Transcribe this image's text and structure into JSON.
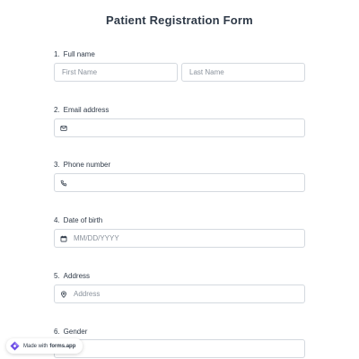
{
  "form": {
    "title": "Patient Registration Form"
  },
  "questions": [
    {
      "number": "1.",
      "label": "Full name",
      "fields": [
        {
          "placeholder": "First Name"
        },
        {
          "placeholder": "Last Name"
        }
      ]
    },
    {
      "number": "2.",
      "label": "Email address",
      "icon": "envelope-icon",
      "placeholder": ""
    },
    {
      "number": "3.",
      "label": "Phone number",
      "icon": "phone-icon",
      "placeholder": ""
    },
    {
      "number": "4.",
      "label": "Date of birth",
      "icon": "calendar-icon",
      "placeholder": "MM/DD/YYYY"
    },
    {
      "number": "5.",
      "label": "Address",
      "icon": "location-pin-icon",
      "placeholder": "Address"
    },
    {
      "number": "6.",
      "label": "Gender",
      "placeholder": ""
    }
  ],
  "badge": {
    "prefix": "Made with",
    "brand": "forms.app"
  },
  "colors": {
    "title": "#2f3a48",
    "border": "#d4d9df",
    "placeholder": "#8a929c",
    "badge_logo": "#6c4de6"
  }
}
